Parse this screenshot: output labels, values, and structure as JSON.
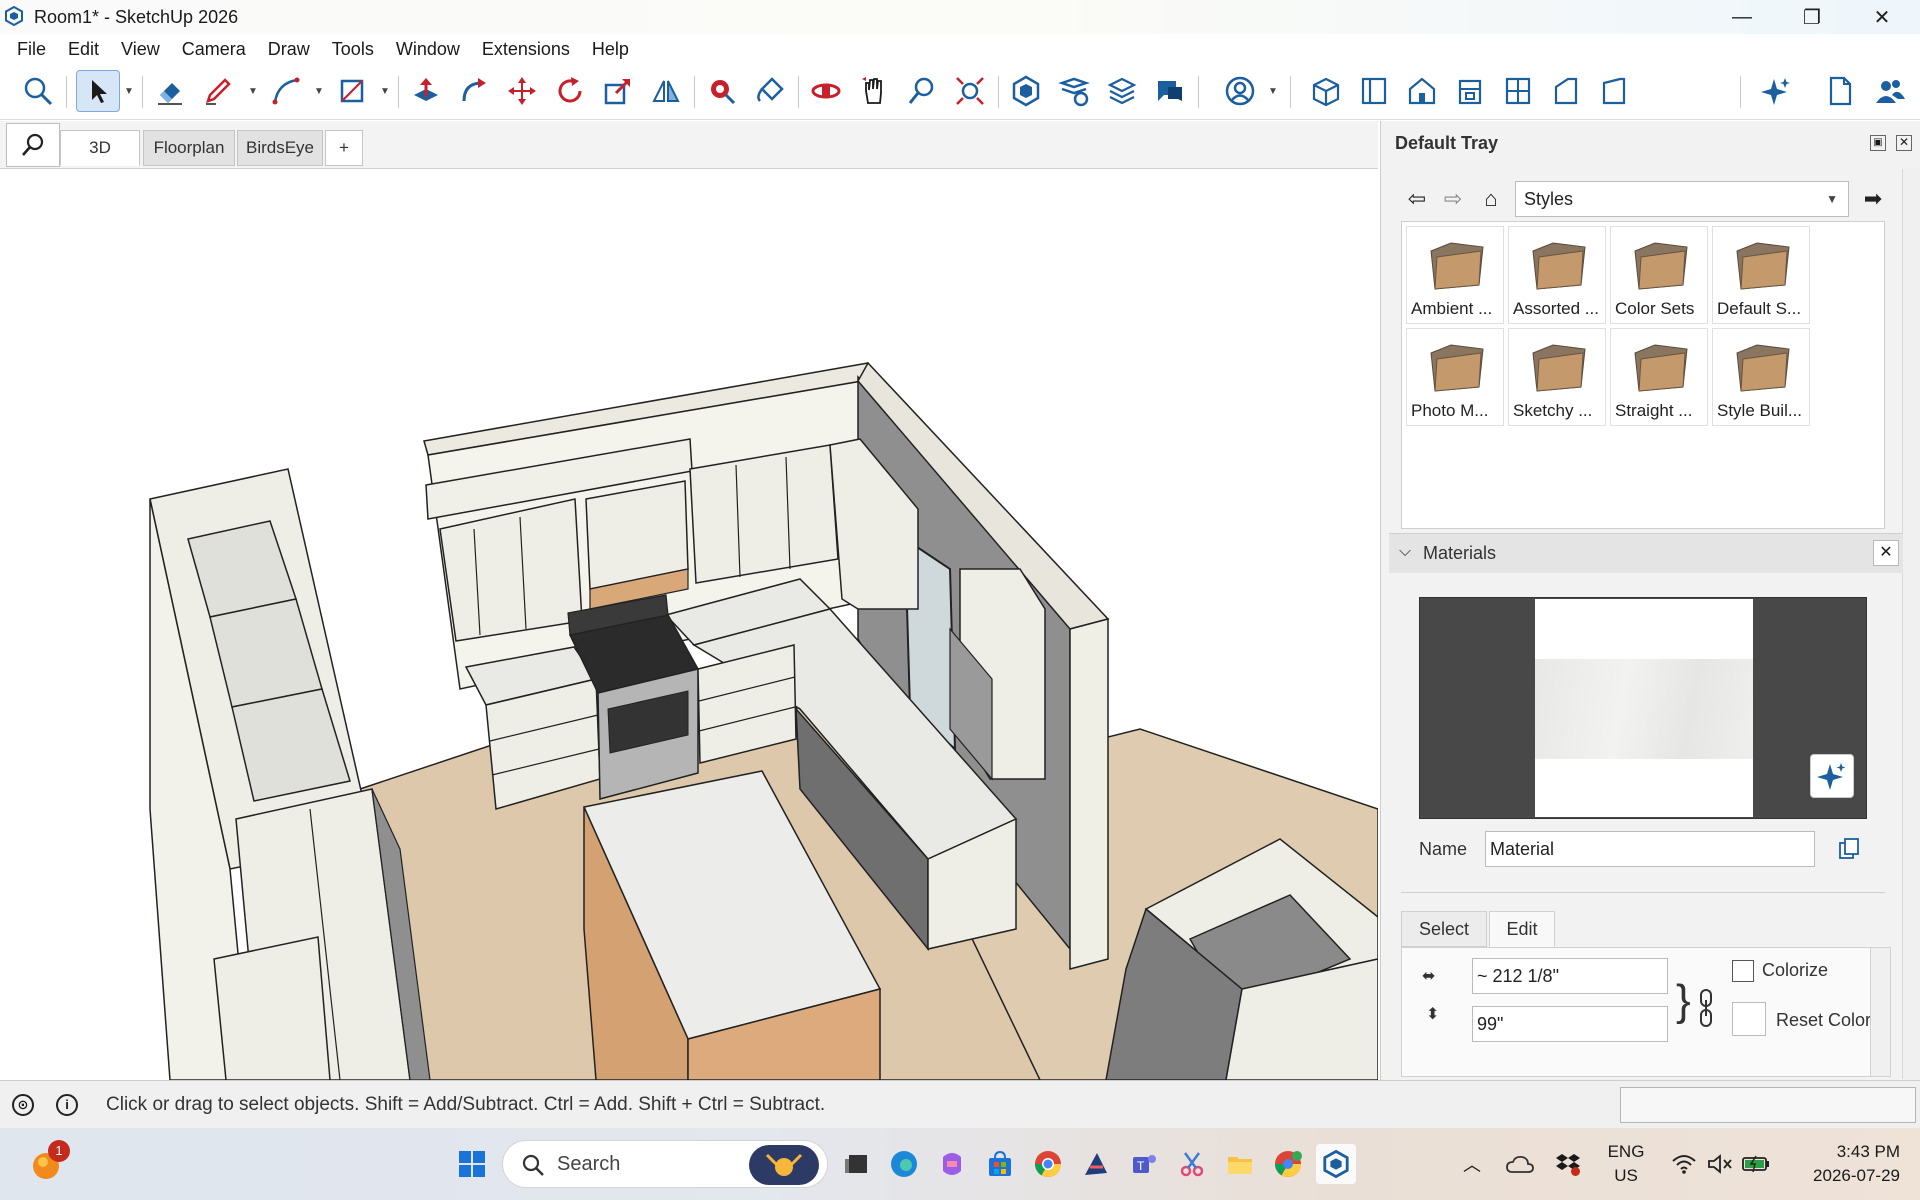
{
  "window": {
    "title": "Room1* - SketchUp 2026",
    "minimize_glyph": "—",
    "restore_glyph": "❐",
    "close_glyph": "✕"
  },
  "menu": [
    "File",
    "Edit",
    "View",
    "Camera",
    "Draw",
    "Tools",
    "Window",
    "Extensions",
    "Help"
  ],
  "toolbar": {
    "tools": [
      "search-tool",
      "select-tool",
      "eraser-tool",
      "pencil-tool",
      "arc-tool",
      "rectangle-tool",
      "push-pull-tool",
      "follow-me-tool",
      "move-tool",
      "rotate-tool",
      "scale-tool",
      "flip-tool",
      "tape-measure-tool",
      "paint-bucket-tool",
      "orbit-tool",
      "pan-tool",
      "zoom-tool",
      "zoom-extents-tool",
      "warehouse-tool",
      "extension-manager-tool",
      "layers-tool",
      "chat-tool",
      "account-tool",
      "iso-view",
      "top-view",
      "front-view",
      "right-view",
      "back-view",
      "left-view",
      "bottom-view",
      "ai-assistant",
      "new-document",
      "collaborators"
    ]
  },
  "scene_tabs": {
    "tabs": [
      "3D",
      "Floorplan",
      "BirdsEye"
    ],
    "active": "3D",
    "add_label": "+"
  },
  "tray": {
    "title": "Default Tray",
    "styles": {
      "selected": "Styles",
      "items": [
        "Ambient ...",
        "Assorted ...",
        "Color Sets",
        "Default S...",
        "Photo M...",
        "Sketchy ...",
        "Straight ...",
        "Style Buil..."
      ]
    },
    "materials": {
      "title": "Materials",
      "name_label": "Name",
      "name_value": "Material",
      "tabs": [
        "Select",
        "Edit"
      ],
      "active_tab": "Edit",
      "width_value": "~ 212 1/8\"",
      "height_value": "99\"",
      "colorize_label": "Colorize",
      "reset_color_label": "Reset Color",
      "colorize_checked": false
    }
  },
  "status": {
    "text": "Click or drag to select objects. Shift = Add/Subtract. Ctrl = Add. Shift + Ctrl = Subtract."
  },
  "taskbar": {
    "search_label": "Search",
    "notification_count": "1",
    "language_line1": "ENG",
    "language_line2": "US",
    "time": "3:43 PM",
    "date": "2026-07-29"
  },
  "colors": {
    "accent": "#0067c0",
    "cabinet": "#efeee6",
    "floor": "#ddc8ab",
    "counter": "#e8e8e4",
    "wall": "#8f8f8f"
  }
}
